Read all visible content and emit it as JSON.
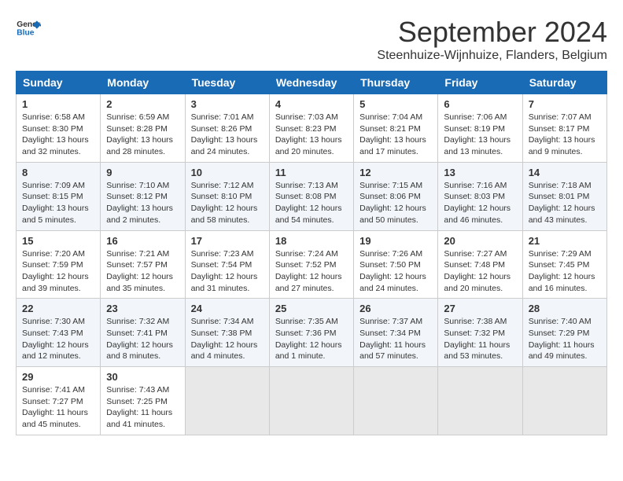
{
  "header": {
    "logo_line1": "General",
    "logo_line2": "Blue",
    "title": "September 2024",
    "subtitle": "Steenhuize-Wijnhuize, Flanders, Belgium"
  },
  "calendar": {
    "days_of_week": [
      "Sunday",
      "Monday",
      "Tuesday",
      "Wednesday",
      "Thursday",
      "Friday",
      "Saturday"
    ],
    "weeks": [
      [
        {
          "day": "1",
          "sunrise": "Sunrise: 6:58 AM",
          "sunset": "Sunset: 8:30 PM",
          "daylight": "Daylight: 13 hours and 32 minutes."
        },
        {
          "day": "2",
          "sunrise": "Sunrise: 6:59 AM",
          "sunset": "Sunset: 8:28 PM",
          "daylight": "Daylight: 13 hours and 28 minutes."
        },
        {
          "day": "3",
          "sunrise": "Sunrise: 7:01 AM",
          "sunset": "Sunset: 8:26 PM",
          "daylight": "Daylight: 13 hours and 24 minutes."
        },
        {
          "day": "4",
          "sunrise": "Sunrise: 7:03 AM",
          "sunset": "Sunset: 8:23 PM",
          "daylight": "Daylight: 13 hours and 20 minutes."
        },
        {
          "day": "5",
          "sunrise": "Sunrise: 7:04 AM",
          "sunset": "Sunset: 8:21 PM",
          "daylight": "Daylight: 13 hours and 17 minutes."
        },
        {
          "day": "6",
          "sunrise": "Sunrise: 7:06 AM",
          "sunset": "Sunset: 8:19 PM",
          "daylight": "Daylight: 13 hours and 13 minutes."
        },
        {
          "day": "7",
          "sunrise": "Sunrise: 7:07 AM",
          "sunset": "Sunset: 8:17 PM",
          "daylight": "Daylight: 13 hours and 9 minutes."
        }
      ],
      [
        {
          "day": "8",
          "sunrise": "Sunrise: 7:09 AM",
          "sunset": "Sunset: 8:15 PM",
          "daylight": "Daylight: 13 hours and 5 minutes."
        },
        {
          "day": "9",
          "sunrise": "Sunrise: 7:10 AM",
          "sunset": "Sunset: 8:12 PM",
          "daylight": "Daylight: 13 hours and 2 minutes."
        },
        {
          "day": "10",
          "sunrise": "Sunrise: 7:12 AM",
          "sunset": "Sunset: 8:10 PM",
          "daylight": "Daylight: 12 hours and 58 minutes."
        },
        {
          "day": "11",
          "sunrise": "Sunrise: 7:13 AM",
          "sunset": "Sunset: 8:08 PM",
          "daylight": "Daylight: 12 hours and 54 minutes."
        },
        {
          "day": "12",
          "sunrise": "Sunrise: 7:15 AM",
          "sunset": "Sunset: 8:06 PM",
          "daylight": "Daylight: 12 hours and 50 minutes."
        },
        {
          "day": "13",
          "sunrise": "Sunrise: 7:16 AM",
          "sunset": "Sunset: 8:03 PM",
          "daylight": "Daylight: 12 hours and 46 minutes."
        },
        {
          "day": "14",
          "sunrise": "Sunrise: 7:18 AM",
          "sunset": "Sunset: 8:01 PM",
          "daylight": "Daylight: 12 hours and 43 minutes."
        }
      ],
      [
        {
          "day": "15",
          "sunrise": "Sunrise: 7:20 AM",
          "sunset": "Sunset: 7:59 PM",
          "daylight": "Daylight: 12 hours and 39 minutes."
        },
        {
          "day": "16",
          "sunrise": "Sunrise: 7:21 AM",
          "sunset": "Sunset: 7:57 PM",
          "daylight": "Daylight: 12 hours and 35 minutes."
        },
        {
          "day": "17",
          "sunrise": "Sunrise: 7:23 AM",
          "sunset": "Sunset: 7:54 PM",
          "daylight": "Daylight: 12 hours and 31 minutes."
        },
        {
          "day": "18",
          "sunrise": "Sunrise: 7:24 AM",
          "sunset": "Sunset: 7:52 PM",
          "daylight": "Daylight: 12 hours and 27 minutes."
        },
        {
          "day": "19",
          "sunrise": "Sunrise: 7:26 AM",
          "sunset": "Sunset: 7:50 PM",
          "daylight": "Daylight: 12 hours and 24 minutes."
        },
        {
          "day": "20",
          "sunrise": "Sunrise: 7:27 AM",
          "sunset": "Sunset: 7:48 PM",
          "daylight": "Daylight: 12 hours and 20 minutes."
        },
        {
          "day": "21",
          "sunrise": "Sunrise: 7:29 AM",
          "sunset": "Sunset: 7:45 PM",
          "daylight": "Daylight: 12 hours and 16 minutes."
        }
      ],
      [
        {
          "day": "22",
          "sunrise": "Sunrise: 7:30 AM",
          "sunset": "Sunset: 7:43 PM",
          "daylight": "Daylight: 12 hours and 12 minutes."
        },
        {
          "day": "23",
          "sunrise": "Sunrise: 7:32 AM",
          "sunset": "Sunset: 7:41 PM",
          "daylight": "Daylight: 12 hours and 8 minutes."
        },
        {
          "day": "24",
          "sunrise": "Sunrise: 7:34 AM",
          "sunset": "Sunset: 7:38 PM",
          "daylight": "Daylight: 12 hours and 4 minutes."
        },
        {
          "day": "25",
          "sunrise": "Sunrise: 7:35 AM",
          "sunset": "Sunset: 7:36 PM",
          "daylight": "Daylight: 12 hours and 1 minute."
        },
        {
          "day": "26",
          "sunrise": "Sunrise: 7:37 AM",
          "sunset": "Sunset: 7:34 PM",
          "daylight": "Daylight: 11 hours and 57 minutes."
        },
        {
          "day": "27",
          "sunrise": "Sunrise: 7:38 AM",
          "sunset": "Sunset: 7:32 PM",
          "daylight": "Daylight: 11 hours and 53 minutes."
        },
        {
          "day": "28",
          "sunrise": "Sunrise: 7:40 AM",
          "sunset": "Sunset: 7:29 PM",
          "daylight": "Daylight: 11 hours and 49 minutes."
        }
      ],
      [
        {
          "day": "29",
          "sunrise": "Sunrise: 7:41 AM",
          "sunset": "Sunset: 7:27 PM",
          "daylight": "Daylight: 11 hours and 45 minutes."
        },
        {
          "day": "30",
          "sunrise": "Sunrise: 7:43 AM",
          "sunset": "Sunset: 7:25 PM",
          "daylight": "Daylight: 11 hours and 41 minutes."
        },
        null,
        null,
        null,
        null,
        null
      ]
    ]
  }
}
